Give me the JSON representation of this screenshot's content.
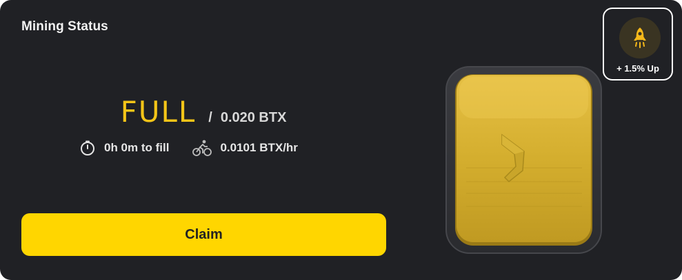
{
  "title": "Mining Status",
  "status": {
    "word": "FULL",
    "slash": "/",
    "amount": "0.020 BTX"
  },
  "info": {
    "fill_time": "0h 0m to fill",
    "fill_icon": "timer-icon",
    "rate": "0.0101 BTX/hr",
    "rate_icon": "cyclist-icon"
  },
  "claim_button": {
    "label": "Claim"
  },
  "boost": {
    "icon": "rocket-icon",
    "label": "+ 1.5% Up"
  },
  "colors": {
    "background": "#202125",
    "accent": "#f5c518",
    "button": "#ffd600",
    "boost_circle": "#3a3422"
  }
}
